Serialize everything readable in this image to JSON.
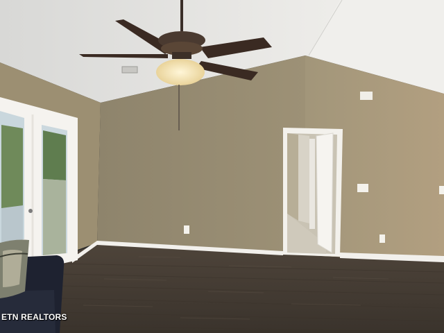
{
  "photo": {
    "subject": "empty-living-room",
    "watermark": "ETN REALTORS",
    "colors": {
      "wall": "#a89a7c",
      "wall_shadow": "#8f8468",
      "ceiling": "#e9e8e4",
      "floor": "#4a4036",
      "trim": "#f4f2ee",
      "fan_blade": "#3a2a22",
      "fan_light": "#f6e7c0"
    },
    "icons": [
      "ceiling-fan-icon",
      "french-door",
      "doorway",
      "sofa",
      "throw-pillow",
      "air-vent",
      "power-outlet",
      "light-switch",
      "smoke-detector"
    ]
  }
}
